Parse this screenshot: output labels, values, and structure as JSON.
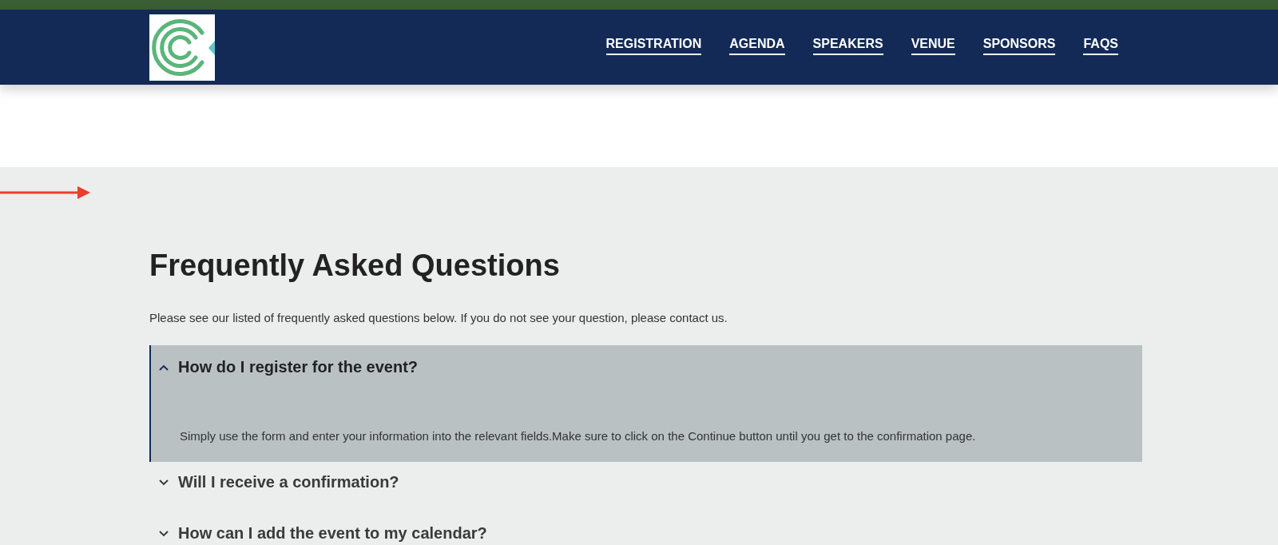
{
  "nav": [
    {
      "label": "REGISTRATION"
    },
    {
      "label": "AGENDA"
    },
    {
      "label": "SPEAKERS"
    },
    {
      "label": "VENUE"
    },
    {
      "label": "SPONSORS"
    },
    {
      "label": "FAQS"
    }
  ],
  "faq": {
    "title": "Frequently Asked Questions",
    "intro": "Please see our listed of frequently asked questions below. If you do not see your question, please contact us.",
    "items": [
      {
        "question": "How do I register for the event?",
        "expanded": true,
        "answer": "Simply use the form and enter your information into the relevant fields.Make sure to click on the Continue button until you get to the confirmation page."
      },
      {
        "question": "Will I receive a confirmation?",
        "expanded": false
      },
      {
        "question": "How can I add the event to my calendar?",
        "expanded": false
      }
    ]
  }
}
